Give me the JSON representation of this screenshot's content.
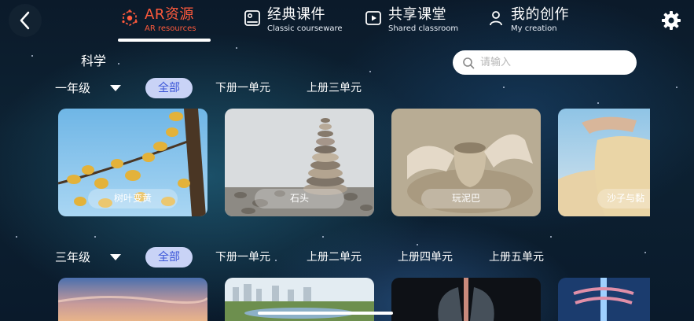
{
  "colors": {
    "accent_active_tab": "#ff5a3c",
    "chip_active_bg": "#c9d3f6",
    "chip_active_text": "#3a55d8"
  },
  "header": {
    "tabs": [
      {
        "label": "AR资源",
        "sublabel": "AR resources",
        "icon": "cube-network-icon",
        "active": true
      },
      {
        "label": "经典课件",
        "sublabel": "Classic courseware",
        "icon": "courseware-icon",
        "active": false
      },
      {
        "label": "共享课堂",
        "sublabel": "Shared  classroom",
        "icon": "play-box-icon",
        "active": false
      },
      {
        "label": "我的创作",
        "sublabel": "My creation",
        "icon": "person-icon",
        "active": false
      }
    ]
  },
  "subject": "科学",
  "search": {
    "placeholder": "请输入",
    "value": ""
  },
  "sections": [
    {
      "grade": "一年级",
      "filters": [
        "全部",
        "下册一单元",
        "上册三单元"
      ],
      "active_filter": "全部",
      "cards": [
        {
          "title": "树叶变黄"
        },
        {
          "title": "石头"
        },
        {
          "title": "玩泥巴"
        },
        {
          "title": "沙子与黏"
        }
      ]
    },
    {
      "grade": "三年级",
      "filters": [
        "全部",
        "下册一单元",
        "上册二单元",
        "上册四单元",
        "上册五单元"
      ],
      "active_filter": "全部",
      "cards": [
        {},
        {},
        {},
        {}
      ]
    }
  ]
}
